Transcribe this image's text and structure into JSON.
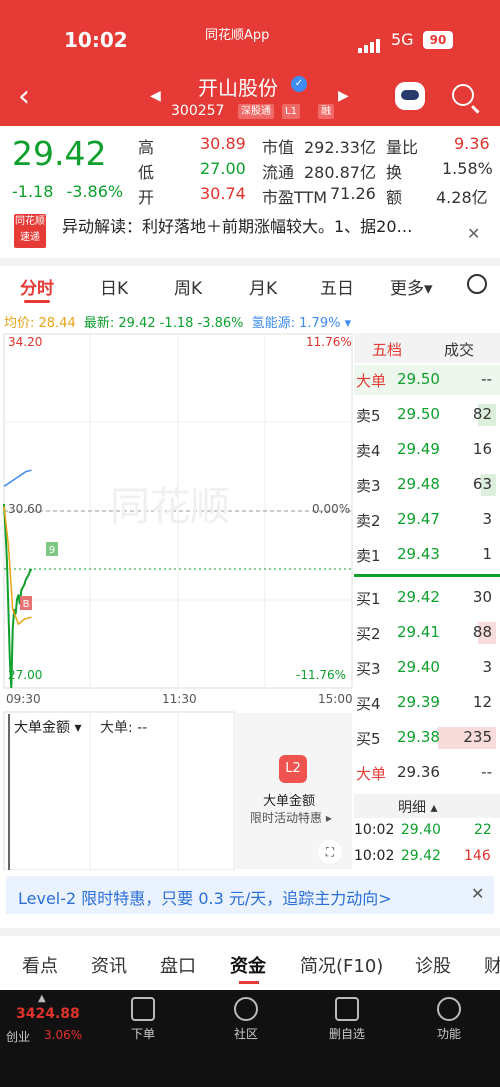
{
  "status": {
    "time": "10:02",
    "app": "同花顺App",
    "network": "5G",
    "battery": "90"
  },
  "header": {
    "name": "开山股份",
    "code": "300257",
    "tags": [
      "深股通",
      "L1",
      "融"
    ]
  },
  "quote": {
    "price": "29.42",
    "change": "-1.18",
    "change_pct": "-3.86%",
    "rows": [
      {
        "l1": "高",
        "v1": "30.89",
        "c1": "red",
        "l2": "市值",
        "v2": "292.33亿",
        "l3": "量比",
        "v3": "9.36",
        "c3": "red"
      },
      {
        "l1": "低",
        "v1": "27.00",
        "c1": "green",
        "l2": "流通",
        "v2": "280.87亿",
        "l3": "换",
        "v3": "1.58%",
        "c3": "dark"
      },
      {
        "l1": "开",
        "v1": "30.74",
        "c1": "red",
        "l2": "市盈TTM",
        "v2": "71.26",
        "l3": "额",
        "v3": "4.28亿",
        "c3": "dark"
      }
    ]
  },
  "news": {
    "logo_top": "同花顺",
    "logo_bottom": "速递",
    "text": "异动解读：利好落地＋前期涨幅较大。1、据20…"
  },
  "tabs": [
    "分时",
    "日K",
    "周K",
    "月K",
    "五日",
    "更多▾"
  ],
  "legend": {
    "avg": "均价: 28.44",
    "latest": "最新: 29.42 -1.18 -3.86%",
    "hydrogen": "氢能源: 1.79% ▾"
  },
  "chart": {
    "y_top": "34.20",
    "y_mid": "30.60",
    "y_bot": "27.00",
    "pct_top": "11.76%",
    "pct_mid": "0.00%",
    "pct_bot": "-11.76%",
    "t_start": "09:30",
    "t_mid": "11:30",
    "t_end": "15:00",
    "watermark": "同花顺",
    "marker_b": "B",
    "marker_9": "9"
  },
  "chart_data": {
    "type": "line",
    "title": "",
    "xlabel": "",
    "ylabel": "",
    "ylim": [
      27.0,
      34.2
    ],
    "series": [
      {
        "name": "",
        "x": [
          "09:30",
          "09:31",
          "09:32",
          "09:33",
          "09:34",
          "09:35",
          "09:36",
          "09:37",
          "09:38",
          "09:39",
          "09:40",
          "09:41",
          "09:42",
          "09:43",
          "09:44",
          "09:45",
          "09:46",
          "09:47",
          "09:48",
          "09:49"
        ],
        "values": [
          30.74,
          30.2,
          29.6,
          28.6,
          27.6,
          27.0,
          28.2,
          28.6,
          28.5,
          28.8,
          28.9,
          28.7,
          29.0,
          29.05,
          29.1,
          29.2,
          29.25,
          29.3,
          29.38,
          29.42
        ]
      },
      {
        "name": "均价",
        "x": [
          "09:30",
          "09:33",
          "09:36",
          "09:40",
          "09:44",
          "09:49"
        ],
        "values": [
          30.7,
          29.9,
          28.6,
          28.3,
          28.4,
          28.44
        ]
      },
      {
        "name": "氢能源",
        "x": [
          "09:30",
          "09:35",
          "09:40",
          "09:45",
          "09:49"
        ],
        "values": [
          31.1,
          31.2,
          31.3,
          31.4,
          31.43
        ]
      }
    ]
  },
  "orderbook": {
    "tab1": "五档",
    "tab2": "成交",
    "rows": [
      {
        "label": "大单",
        "price": "29.50",
        "vol": "--",
        "pc": "green",
        "bar": 0
      },
      {
        "label": "卖5",
        "price": "29.50",
        "vol": "82",
        "pc": "green",
        "bar": 0.12
      },
      {
        "label": "卖4",
        "price": "29.49",
        "vol": "16",
        "pc": "green",
        "bar": 0
      },
      {
        "label": "卖3",
        "price": "29.48",
        "vol": "63",
        "pc": "green",
        "bar": 0.1
      },
      {
        "label": "卖2",
        "price": "29.47",
        "vol": "3",
        "pc": "green",
        "bar": 0
      },
      {
        "label": "卖1",
        "price": "29.43",
        "vol": "1",
        "pc": "green",
        "bar": 0
      },
      {
        "label": "买1",
        "price": "29.42",
        "vol": "30",
        "pc": "green",
        "bar": 0
      },
      {
        "label": "买2",
        "price": "29.41",
        "vol": "88",
        "pc": "green",
        "bar": 0.12
      },
      {
        "label": "买3",
        "price": "29.40",
        "vol": "3",
        "pc": "green",
        "bar": 0
      },
      {
        "label": "买4",
        "price": "29.39",
        "vol": "12",
        "pc": "green",
        "bar": 0
      },
      {
        "label": "买5",
        "price": "29.38",
        "vol": "235",
        "pc": "green",
        "bar": 0.4
      },
      {
        "label": "大单",
        "price": "29.36",
        "vol": "--",
        "pc": "dark",
        "bar": 0
      }
    ]
  },
  "detail": {
    "title": "明细 ▴",
    "trades": [
      {
        "time": "10:02",
        "price": "29.40",
        "vol": "22"
      },
      {
        "time": "10:02",
        "price": "29.42",
        "vol": "146"
      }
    ]
  },
  "indicator": {
    "label": "大单金额 ▾",
    "label2": "大单: --"
  },
  "promo": {
    "icon": "L2",
    "title": "大单金额",
    "sub": "限时活动特惠 ▸"
  },
  "banner": {
    "text": "Level-2 限时特惠，只要 0.3 元/天，追踪主力动向>"
  },
  "bottom_tabs": [
    "看点",
    "资讯",
    "盘口",
    "资金",
    "简况(F10)",
    "诊股",
    "财"
  ],
  "nav": {
    "index_value": "3424.88",
    "index_name": "创业",
    "index_pct": "3.06%",
    "items": [
      "下单",
      "社区",
      "删自选",
      "功能"
    ]
  }
}
